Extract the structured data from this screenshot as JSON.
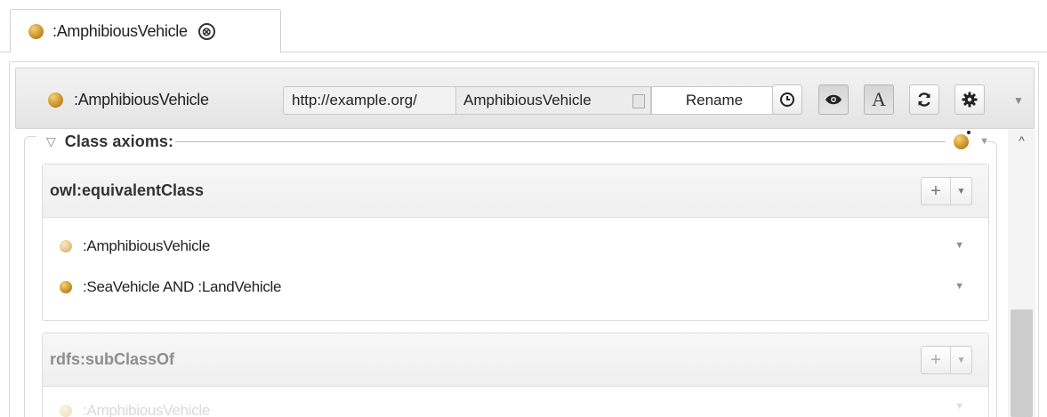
{
  "tab": {
    "label": ":AmphibiousVehicle",
    "icon": "class-icon",
    "close_icon": "close-icon",
    "close_glyph": "⊗"
  },
  "header": {
    "entity_label": ":AmphibiousVehicle",
    "iri_prefix": "http://example.org/",
    "iri_local": "AmphibiousVehicle",
    "rename_label": "Rename",
    "toolbar_buttons": [
      {
        "icon": "history-icon",
        "pressed": false
      },
      {
        "icon": "eye-icon",
        "pressed": true
      },
      {
        "icon": "font-icon",
        "glyph": "A",
        "pressed": true
      },
      {
        "icon": "refresh-icon",
        "pressed": false
      },
      {
        "icon": "gear-icon",
        "pressed": false
      }
    ],
    "menu_caret": "▼"
  },
  "section": {
    "title": "Class axioms:",
    "toggle": "▽",
    "caret": "▼"
  },
  "panels": [
    {
      "title": "owl:equivalentClass",
      "plus": "+",
      "caret": "▼",
      "rows": [
        {
          "text": ":AmphibiousVehicle",
          "dot": "pale",
          "caret": "▼"
        },
        {
          "text": ":SeaVehicle AND :LandVehicle",
          "dot": "gold",
          "caret": "▼"
        }
      ]
    },
    {
      "title": "rdfs:subClassOf",
      "plus": "+",
      "caret": "▼",
      "rows": [
        {
          "text": ":AmphibiousVehicle",
          "dot": "faded",
          "caret": "▼"
        }
      ]
    }
  ],
  "scrollbar": {
    "up_glyph": "^",
    "position_fraction": 0.62
  },
  "colors": {
    "class_dot": "#d7a036",
    "header_bg": "#e9e9e9",
    "border": "#d4d4d4"
  }
}
